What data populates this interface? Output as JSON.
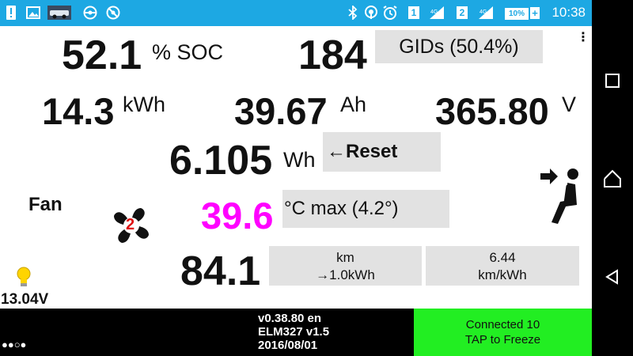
{
  "status_bar": {
    "sim1": "1",
    "sim2": "2",
    "battery_level": "10%",
    "battery_charging": "+",
    "time": "10:38",
    "icons": [
      "alert-icon",
      "image-icon",
      "car-icon",
      "steering-icon",
      "wifi-off-icon",
      "bluetooth-icon",
      "hotspot-icon",
      "alarm-icon",
      "signal-icon"
    ]
  },
  "menu_glyph": "⋮",
  "soc": {
    "value": "52.1",
    "unit": "% SOC"
  },
  "gids": {
    "value": "184",
    "label": "GIDs (50.4%)"
  },
  "energy": {
    "kwh_value": "14.3",
    "kwh_unit": "kWh",
    "ah_value": "39.67",
    "ah_unit": "Ah",
    "v_value": "365.80",
    "v_unit": "V"
  },
  "wh": {
    "value": "6.105",
    "unit": "Wh",
    "reset_label": "←Reset"
  },
  "fan": {
    "label": "Fan",
    "level": "2"
  },
  "temp": {
    "value": "39.6",
    "label": "°C max (4.2°)",
    "color": "#ff00ff"
  },
  "distance": {
    "value": "84.1",
    "km_label": "km",
    "per_kwh_label": "→1.0kWh",
    "eff_value": "6.44",
    "eff_unit": "km/kWh"
  },
  "voltage_12v": {
    "value": "13.04V"
  },
  "footer": {
    "version": "v0.38.80 en",
    "elm": "ELM327 v1.5",
    "date": "2016/08/01",
    "connected": "Connected 10",
    "tap": "TAP to Freeze",
    "page_dots": "●●○●"
  },
  "colors": {
    "status_bar": "#1da8e3",
    "connected_bg": "#22ee22",
    "button_gray": "#e2e2e2"
  }
}
